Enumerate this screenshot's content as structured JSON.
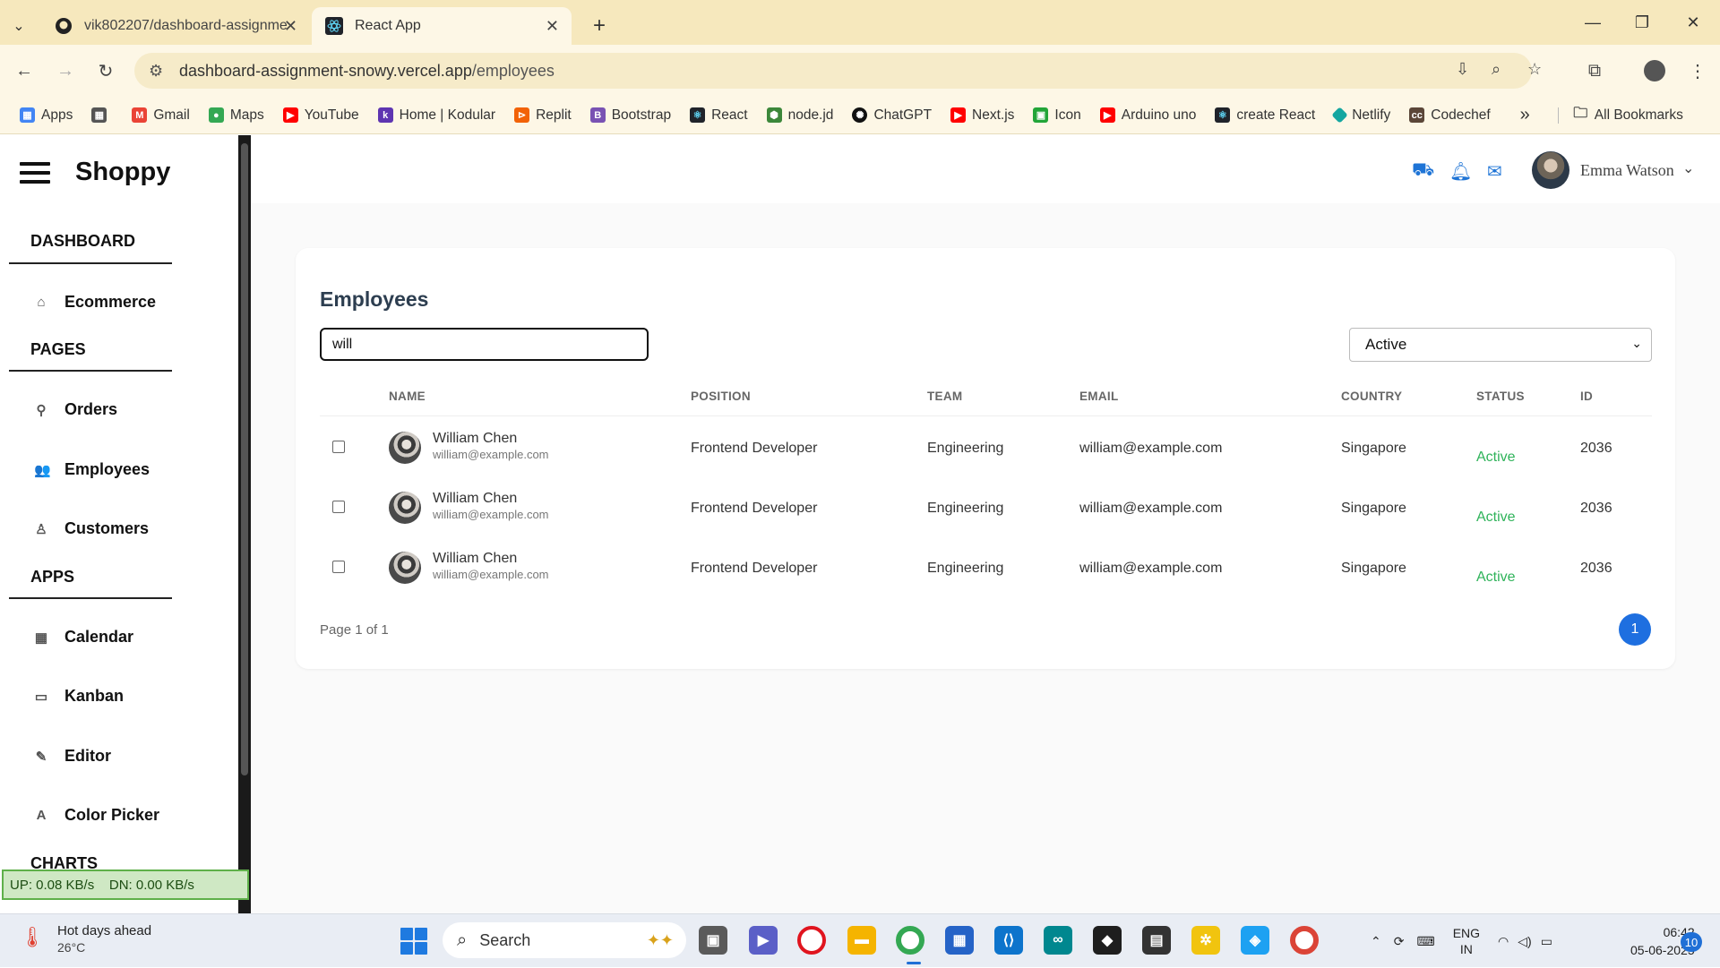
{
  "browser": {
    "tabs": [
      {
        "title": "vik802207/dashboard-assignme",
        "icon": "github-icon"
      },
      {
        "title": "React App",
        "icon": "react-icon"
      }
    ],
    "new_tab_label": "+",
    "url_host": "dashboard-assignment-snowy.vercel.app",
    "url_path": "/employees"
  },
  "bookmarks": [
    {
      "label": "Apps",
      "color": "#4285f4"
    },
    {
      "label": "",
      "color": "#555555"
    },
    {
      "label": "Gmail",
      "color": "#ea4335"
    },
    {
      "label": "Maps",
      "color": "#34a853"
    },
    {
      "label": "YouTube",
      "color": "#ff0000"
    },
    {
      "label": "Home | Kodular",
      "color": "#5e35b1"
    },
    {
      "label": "Replit",
      "color": "#f26207"
    },
    {
      "label": "Bootstrap",
      "color": "#7952b3"
    },
    {
      "label": "React",
      "color": "#20232a"
    },
    {
      "label": "node.jd",
      "color": "#3c873a"
    },
    {
      "label": "ChatGPT",
      "color": "#111111"
    },
    {
      "label": "Next.js",
      "color": "#ff0000"
    },
    {
      "label": "Icon",
      "color": "#22a538"
    },
    {
      "label": "Arduino uno",
      "color": "#ff0000"
    },
    {
      "label": "create React",
      "color": "#20232a"
    },
    {
      "label": "Netlify",
      "color": "#14a6a0"
    },
    {
      "label": "Codechef",
      "color": "#5b4638"
    }
  ],
  "bookmarks_more": "»",
  "bookmarks_all": "All Bookmarks",
  "sidebar": {
    "brand": "Shoppy",
    "sections": [
      {
        "title": "DASHBOARD",
        "items": [
          {
            "label": "Ecommerce",
            "icon": "home-icon"
          }
        ]
      },
      {
        "title": "PAGES",
        "items": [
          {
            "label": "Orders",
            "icon": "map-pin-icon"
          },
          {
            "label": "Employees",
            "icon": "people-icon"
          },
          {
            "label": "Customers",
            "icon": "person-icon"
          }
        ]
      },
      {
        "title": "APPS",
        "items": [
          {
            "label": "Calendar",
            "icon": "calendar-icon"
          },
          {
            "label": "Kanban",
            "icon": "folder-icon"
          },
          {
            "label": "Editor",
            "icon": "pencil-icon"
          },
          {
            "label": "Color Picker",
            "icon": "text-a-icon"
          }
        ]
      },
      {
        "title": "CHARTS",
        "items": []
      }
    ]
  },
  "net_widget": "UP: 0.08 KB/s    DN: 0.00 KB/s",
  "header": {
    "user_name": "Emma Watson",
    "accent": "#1e74d6"
  },
  "employees": {
    "title": "Employees",
    "search_value": "will",
    "status_filter": "Active",
    "columns": [
      "NAME",
      "POSITION",
      "TEAM",
      "EMAIL",
      "COUNTRY",
      "STATUS",
      "ID"
    ],
    "rows": [
      {
        "name": "William Chen",
        "email": "william@example.com",
        "position": "Frontend Developer",
        "team": "Engineering",
        "email_col": "william@example.com",
        "country": "Singapore",
        "status": "Active",
        "id": "2036"
      },
      {
        "name": "William Chen",
        "email": "william@example.com",
        "position": "Frontend Developer",
        "team": "Engineering",
        "email_col": "william@example.com",
        "country": "Singapore",
        "status": "Active",
        "id": "2036"
      },
      {
        "name": "William Chen",
        "email": "william@example.com",
        "position": "Frontend Developer",
        "team": "Engineering",
        "email_col": "william@example.com",
        "country": "Singapore",
        "status": "Active",
        "id": "2036"
      }
    ],
    "page_info": "Page 1 of 1",
    "current_page": "1",
    "status_color": "#2fb35a",
    "page_color": "#1e6fe0"
  },
  "taskbar": {
    "weather_title": "Hot days ahead",
    "weather_temp": "26°C",
    "search_label": "Search",
    "lang_top": "ENG",
    "lang_bottom": "IN",
    "time": "06:42",
    "date": "05-06-2025",
    "notifications": "10"
  }
}
